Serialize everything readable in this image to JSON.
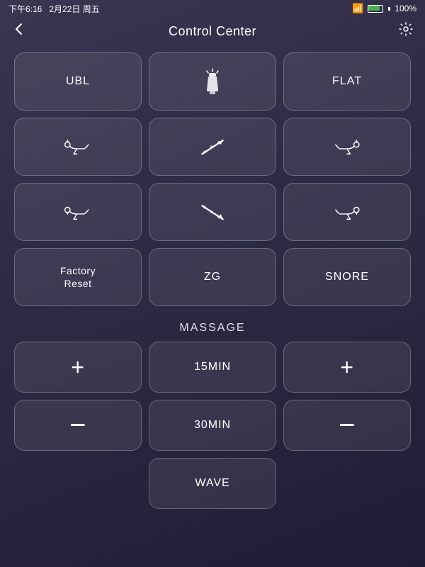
{
  "statusBar": {
    "time": "下午6:16",
    "date": "2月22日 周五",
    "wifi": "100%",
    "signal": "WiFi"
  },
  "header": {
    "title": "Control Center",
    "backIcon": "←",
    "settingsIcon": "⚙"
  },
  "grid": {
    "row1": [
      {
        "id": "ubl",
        "label": "UBL",
        "type": "text"
      },
      {
        "id": "torch",
        "label": "",
        "type": "torch"
      },
      {
        "id": "flat",
        "label": "FLAT",
        "type": "text"
      }
    ],
    "row2": [
      {
        "id": "head-up",
        "label": "",
        "type": "head-up"
      },
      {
        "id": "back-up",
        "label": "",
        "type": "back-up"
      },
      {
        "id": "leg-up",
        "label": "",
        "type": "leg-up"
      }
    ],
    "row3": [
      {
        "id": "head-down",
        "label": "",
        "type": "head-down"
      },
      {
        "id": "back-down",
        "label": "",
        "type": "back-down"
      },
      {
        "id": "leg-down",
        "label": "",
        "type": "leg-down"
      }
    ],
    "row4": [
      {
        "id": "factory-reset",
        "label": "Factory\nReset",
        "type": "text-small"
      },
      {
        "id": "zg",
        "label": "ZG",
        "type": "text"
      },
      {
        "id": "snore",
        "label": "SNORE",
        "type": "text"
      }
    ]
  },
  "massage": {
    "title": "MASSAGE",
    "col1": [
      {
        "id": "plus-left",
        "label": "+",
        "type": "plus"
      },
      {
        "id": "minus-left",
        "label": "−",
        "type": "minus"
      }
    ],
    "col2": [
      {
        "id": "15min",
        "label": "15MIN",
        "type": "text"
      },
      {
        "id": "30min",
        "label": "30MIN",
        "type": "text"
      }
    ],
    "col3": [
      {
        "id": "plus-right",
        "label": "+",
        "type": "plus"
      },
      {
        "id": "minus-right",
        "label": "−",
        "type": "minus"
      }
    ],
    "wave": {
      "id": "wave",
      "label": "WAVE"
    }
  }
}
